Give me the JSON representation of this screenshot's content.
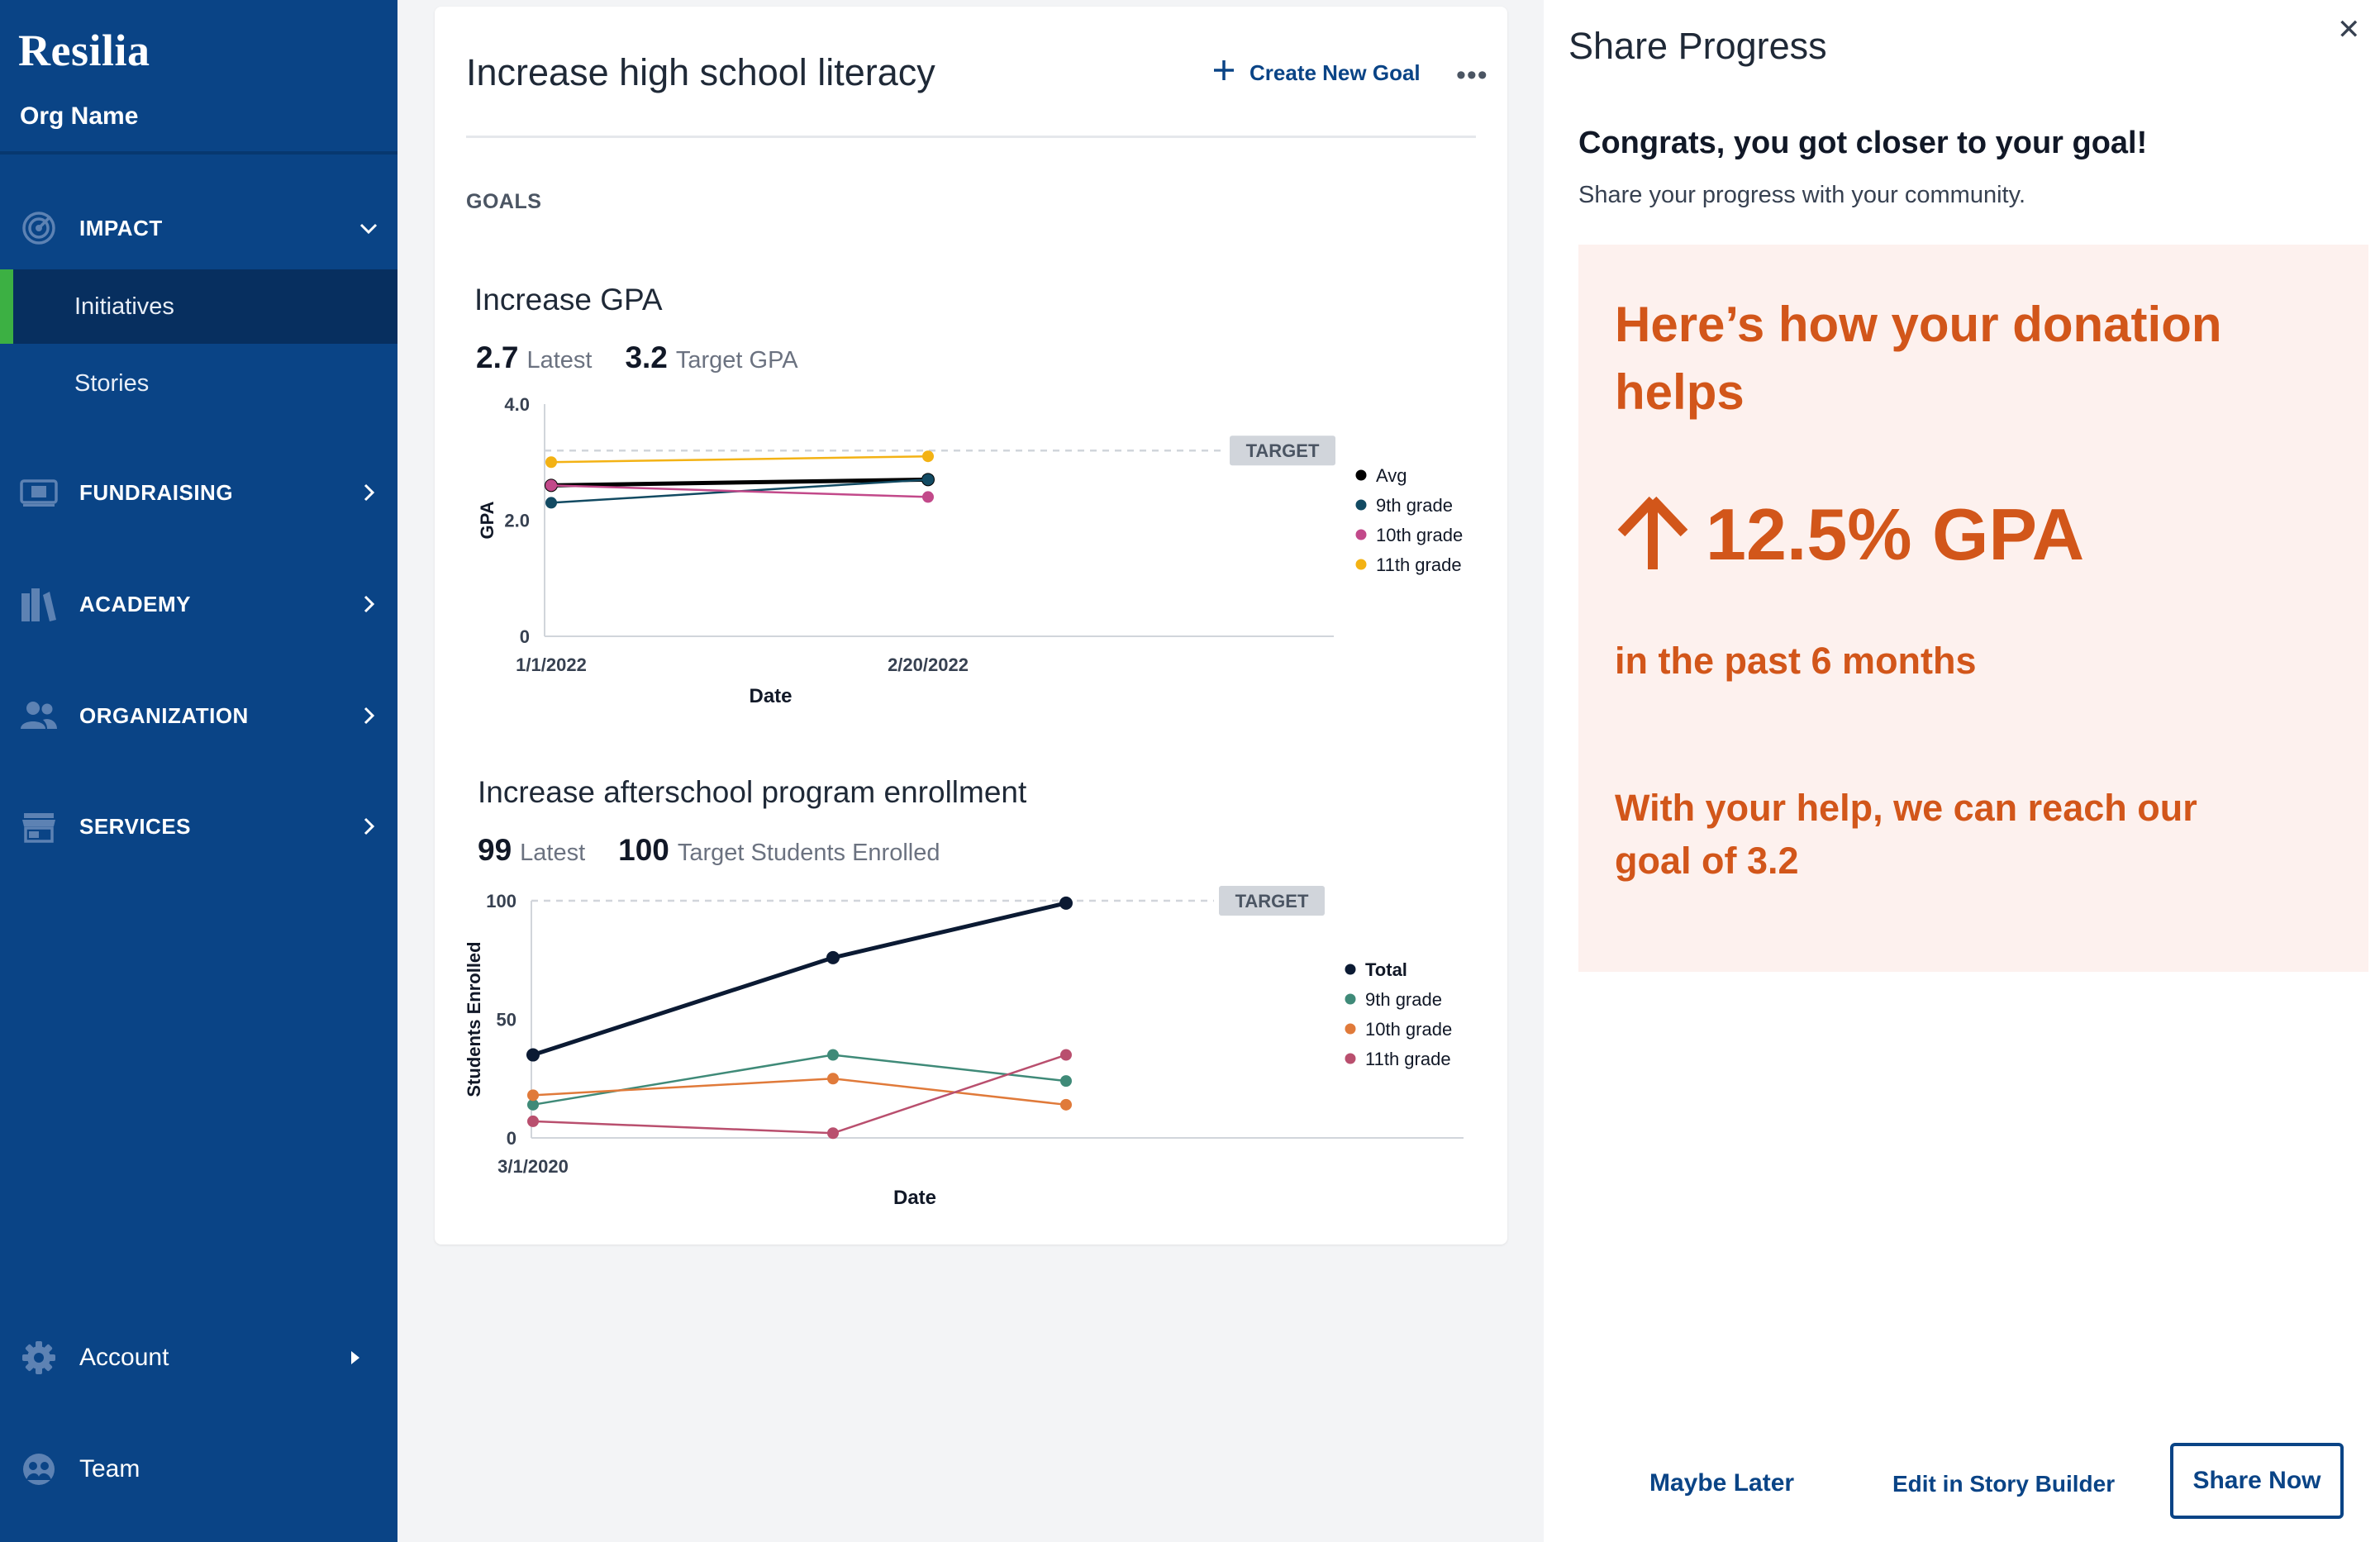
{
  "sidebar": {
    "brand": "Resilia",
    "org_name": "Org Name",
    "sections": [
      {
        "label": "IMPACT",
        "icon": "target-icon"
      },
      {
        "label": "FUNDRAISING",
        "icon": "money-icon"
      },
      {
        "label": "ACADEMY",
        "icon": "books-icon"
      },
      {
        "label": "ORGANIZATION",
        "icon": "people-icon"
      },
      {
        "label": "SERVICES",
        "icon": "storefront-icon"
      }
    ],
    "sub_items": [
      "Initiatives",
      "Stories"
    ],
    "bottom": {
      "account": "Account",
      "team": "Team"
    },
    "colors": {
      "background": "#0a4486",
      "active": "#072f5f",
      "accent": "#3cb043"
    }
  },
  "main": {
    "title": "Increase high school literacy",
    "create_label": "Create New Goal",
    "more_label": "•••",
    "goals_label": "GOALS",
    "goals": [
      {
        "title": "Increase GPA",
        "latest_value": "2.7",
        "latest_label": "Latest",
        "target_value": "3.2",
        "target_label": "Target GPA"
      },
      {
        "title": "Increase afterschool program enrollment",
        "latest_value": "99",
        "latest_label": "Latest",
        "target_value": "100",
        "target_label": "Target Students Enrolled"
      }
    ]
  },
  "chart_data": [
    {
      "type": "line",
      "title": "Increase GPA",
      "xlabel": "Date",
      "ylabel": "GPA",
      "x": [
        "1/1/2022",
        "2/20/2022"
      ],
      "x_tick_labels": [
        "1/1/2022",
        "2/20/2022"
      ],
      "y_tick_labels": [
        "0",
        "2.0",
        "4.0"
      ],
      "ylim": [
        0,
        4.0
      ],
      "target": {
        "value": 3.2,
        "label": "TARGET"
      },
      "legend_position": "right",
      "series": [
        {
          "name": "Avg",
          "values": [
            2.6,
            2.7
          ],
          "color": "#000000"
        },
        {
          "name": "9th grade",
          "values": [
            2.3,
            2.7
          ],
          "color": "#124a62"
        },
        {
          "name": "10th grade",
          "values": [
            2.6,
            2.4
          ],
          "color": "#c2498a"
        },
        {
          "name": "11th grade",
          "values": [
            3.0,
            3.1
          ],
          "color": "#f3b214"
        }
      ]
    },
    {
      "type": "line",
      "title": "Increase afterschool program enrollment",
      "xlabel": "Date",
      "ylabel": "Students Enrolled",
      "x": [
        "3/1/2020",
        "",
        ""
      ],
      "x_tick_labels": [
        "3/1/2020"
      ],
      "y_tick_labels": [
        "0",
        "50",
        "100"
      ],
      "ylim": [
        0,
        100
      ],
      "target": {
        "value": 100,
        "label": "TARGET"
      },
      "legend_position": "right",
      "series": [
        {
          "name": "Total",
          "values": [
            35,
            76,
            99
          ],
          "color": "#0b1a33"
        },
        {
          "name": "9th grade",
          "values": [
            14,
            35,
            24
          ],
          "color": "#3f8a78"
        },
        {
          "name": "10th grade",
          "values": [
            18,
            25,
            14
          ],
          "color": "#e07a3a"
        },
        {
          "name": "11th grade",
          "values": [
            7,
            2,
            35
          ],
          "color": "#b94f6e"
        }
      ]
    }
  ],
  "share": {
    "title": "Share Progress",
    "close": "✕",
    "congrats": "Congrats, you got closer to your goal!",
    "subtitle": "Share your progress with your community.",
    "promo_heading": "Here’s how your donation helps",
    "promo_stat": "12.5% GPA",
    "promo_period": "in the past 6 months",
    "promo_goal": "With your help, we can reach our goal of 3.2",
    "maybe_later": "Maybe Later",
    "edit_story": "Edit in Story Builder",
    "share_now": "Share Now",
    "colors": {
      "promo_bg": "#fdf1ee",
      "promo_text": "#d2561a",
      "brand": "#0a4486"
    }
  }
}
